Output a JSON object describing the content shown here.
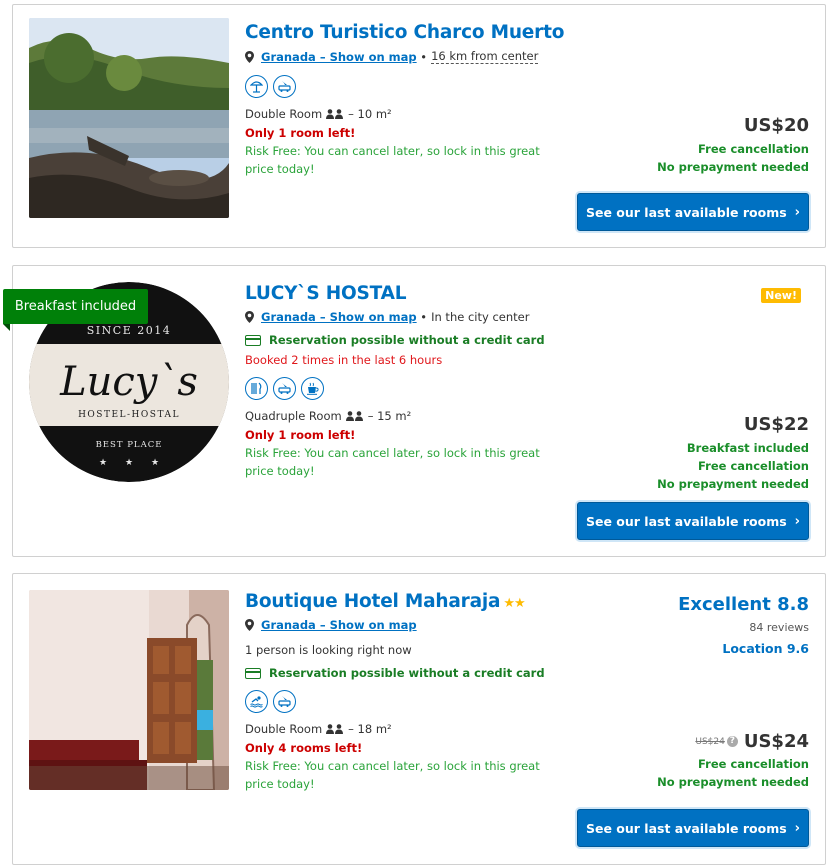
{
  "colors": {
    "brand_blue": "#0071c2",
    "green": "#1a8e2a",
    "urgent_red": "#cc0000",
    "ribbon_green": "#008009",
    "badge_yellow": "#febb02"
  },
  "common": {
    "cta_label": "See our last available rooms",
    "risk_free": "Risk Free: You can cancel later, so lock in this great price today!",
    "free_cancellation": "Free cancellation",
    "no_prepayment": "No prepayment needed",
    "show_on_map": "Granada – Show on map",
    "no_credit_card": "Reservation possible without a credit card"
  },
  "hotels": [
    {
      "name": "Centro Turistico Charco Muerto",
      "distance": "16 km from center",
      "facility_icons": [
        "beach-umbrella-icon",
        "airport-shuttle-icon"
      ],
      "room": "Double Room",
      "room_size": "– 10 m²",
      "rooms_left": "Only 1 room left!",
      "price": "US$20",
      "photo": "beach-photo"
    },
    {
      "name": "LUCY`S HOSTAL",
      "ribbon": "Breakfast included",
      "badge": "New!",
      "distance": "In the city center",
      "booked": "Booked 2 times in the last 6 hours",
      "facility_icons": [
        "restaurant-icon",
        "airport-shuttle-icon",
        "coffee-icon"
      ],
      "room": "Quadruple Room",
      "room_size": "– 15 m²",
      "rooms_left": "Only 1 room left!",
      "price": "US$22",
      "breakfast": "Breakfast included",
      "logo": {
        "since": "SINCE 2014",
        "name": "Lucy`s",
        "sub": "HOSTEL-HOSTAL",
        "tag": "BEST PLACE"
      }
    },
    {
      "name": "Boutique Hotel Maharaja",
      "stars": "★★",
      "looking": "1 person is looking right now",
      "facility_icons": [
        "swimming-pool-icon",
        "airport-shuttle-icon"
      ],
      "room": "Double Room",
      "room_size": "– 18 m²",
      "rooms_left": "Only 4 rooms left!",
      "old_price": "US$24",
      "price": "US$24",
      "score_label": "Excellent 8.8",
      "reviews": "84 reviews",
      "location_score": "Location 9.6",
      "photo": "room-photo"
    }
  ]
}
